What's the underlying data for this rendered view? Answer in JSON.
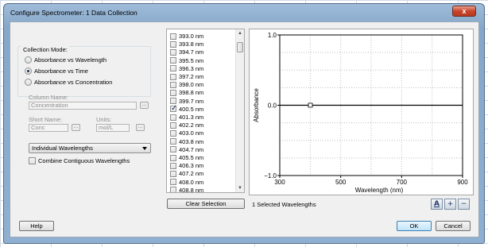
{
  "window": {
    "title": "Configure Spectrometer: 1 Data Collection",
    "close_label": "x"
  },
  "collection_mode": {
    "group_label": "Collection Mode:",
    "options": [
      {
        "label": "Absorbance vs Wavelength",
        "selected": false
      },
      {
        "label": "Absorbance vs Time",
        "selected": true
      },
      {
        "label": "Absorbance vs Concentration",
        "selected": false
      }
    ]
  },
  "column_name": {
    "label": "Column Name:",
    "value": "Concentration",
    "button": "..."
  },
  "short_name": {
    "label": "Short Name:",
    "value": "Conc",
    "button": "..."
  },
  "units": {
    "label": "Units:",
    "value": "mol/L",
    "button": "..."
  },
  "wavelength_mode": {
    "selected": "Individual Wavelengths"
  },
  "combine": {
    "label": "Combine Contiguous Wavelengths",
    "checked": false
  },
  "wavelengths": [
    {
      "label": "393.0 nm",
      "checked": false
    },
    {
      "label": "393.8 nm",
      "checked": false
    },
    {
      "label": "394.7 nm",
      "checked": false
    },
    {
      "label": "395.5 nm",
      "checked": false
    },
    {
      "label": "396.3 nm",
      "checked": false
    },
    {
      "label": "397.2 nm",
      "checked": false
    },
    {
      "label": "398.0 nm",
      "checked": false
    },
    {
      "label": "398.8 nm",
      "checked": false
    },
    {
      "label": "399.7 nm",
      "checked": false
    },
    {
      "label": "400.5 nm",
      "checked": true
    },
    {
      "label": "401.3 nm",
      "checked": false
    },
    {
      "label": "402.2 nm",
      "checked": false
    },
    {
      "label": "403.0 nm",
      "checked": false
    },
    {
      "label": "403.8 nm",
      "checked": false
    },
    {
      "label": "404.7 nm",
      "checked": false
    },
    {
      "label": "405.5 nm",
      "checked": false
    },
    {
      "label": "406.3 nm",
      "checked": false
    },
    {
      "label": "407.2 nm",
      "checked": false
    },
    {
      "label": "408.0 nm",
      "checked": false
    },
    {
      "label": "408.8 nm",
      "checked": false
    }
  ],
  "buttons": {
    "clear_selection": "Clear Selection",
    "help": "Help",
    "ok": "OK",
    "cancel": "Cancel"
  },
  "status": "1 Selected Wavelengths",
  "tools": [
    {
      "icon": "autoscale-icon",
      "glyph": "A"
    },
    {
      "icon": "zoom-in-icon",
      "glyph": "+"
    },
    {
      "icon": "zoom-out-icon",
      "glyph": "−"
    }
  ],
  "chart_data": {
    "type": "line",
    "xlabel": "Wavelength (nm)",
    "ylabel": "Absorbance",
    "xlim": [
      300,
      900
    ],
    "ylim": [
      -1.0,
      1.0
    ],
    "xticks": [
      "300",
      "500",
      "700",
      "900"
    ],
    "yticks": [
      "1.0",
      "0.0",
      "−1.0"
    ],
    "series": [
      {
        "x": [
          300,
          900
        ],
        "y": [
          0,
          0
        ]
      }
    ],
    "marker": {
      "x": 400.5,
      "y": 0
    }
  }
}
